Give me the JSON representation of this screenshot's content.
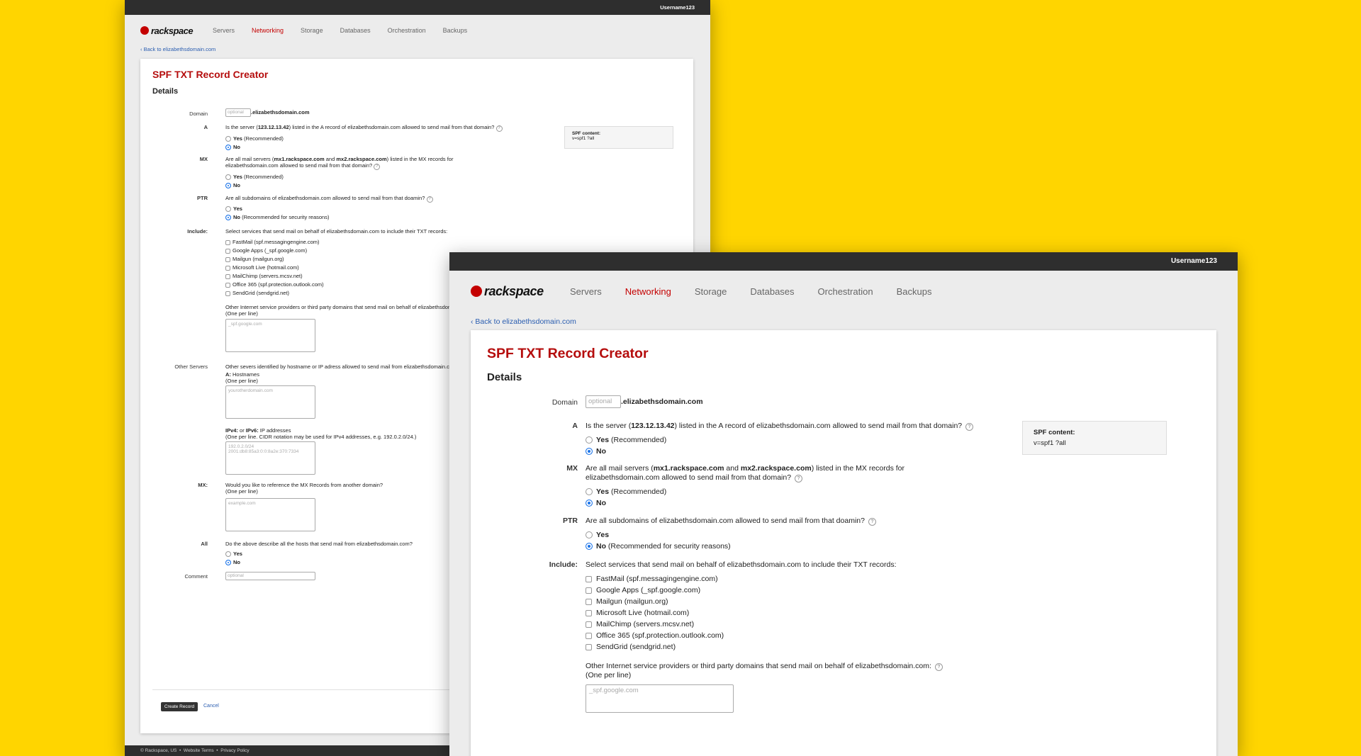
{
  "topbar": {
    "username": "Username123"
  },
  "nav": {
    "logo": "rackspace",
    "items": [
      "Servers",
      "Networking",
      "Storage",
      "Databases",
      "Orchestration",
      "Backups"
    ],
    "active": "Networking"
  },
  "back_link": "‹ Back to elizabethsdomain.com",
  "page": {
    "title": "SPF TXT Record Creator",
    "subtitle": "Details"
  },
  "domain": {
    "label": "Domain",
    "placeholder": "optional",
    "suffix": ".elizabethsdomain.com"
  },
  "spf": {
    "label": "SPF content:",
    "value": "v=spf1 ?all"
  },
  "a_record": {
    "label": "A",
    "q_pre": "Is the server (",
    "q_bold": "123.12.13.42",
    "q_post": ") listed in the A record of elizabethsdomain.com allowed to send mail from that domain?",
    "yes": "Yes",
    "yes_note": "(Recommended)",
    "no": "No"
  },
  "mx_record": {
    "label": "MX",
    "q_pre": "Are all mail servers (",
    "q_bold1": "mx1.rackspace.com",
    "q_mid": " and ",
    "q_bold2": "mx2.rackspace.com",
    "q_post1": ") listed in the MX records for",
    "q_post2": "elizabethsdomain.com allowed to send mail from that domain?",
    "yes": "Yes",
    "yes_note": "(Recommended)",
    "no": "No"
  },
  "ptr_record": {
    "label": "PTR",
    "q": "Are all subdomains of elizabethsdomain.com allowed to send mail from that doamin?",
    "yes": "Yes",
    "no": "No",
    "no_note": "(Recommended for security reasons)"
  },
  "include": {
    "label": "Include:",
    "q": "Select services that send mail on behalf of elizabethsdomain.com to include their TXT records:",
    "services": [
      "FastMail (spf.messagingengine.com)",
      "Google Apps (_spf.google.com)",
      "Mailgun (mailgun.org)",
      "Microsoft Live (hotmail.com)",
      "MailChimp (servers.mcsv.net)",
      "Office 365 (spf.protection.outlook.com)",
      "SendGrid (sendgrid.net)"
    ],
    "other_q": "Other Internet service providers or third party domains that send mail on behalf of elizabethsdomain.com:",
    "one_per_line": "(One per line)",
    "other_placeholder": "_spf.google.com"
  },
  "other_servers": {
    "label": "Other Servers",
    "q": "Other severs identified by hostname or IP adress allowed to send mail from elizabethsdomain.com:",
    "hostnames_bold": "A:",
    "hostnames": " Hostnames",
    "hostnames_hint": "(One per line)",
    "hostnames_placeholder": "yourotherdomain.com",
    "ip_bold1": "IPv4:",
    "ip_mid": " or ",
    "ip_bold2": "IPv6:",
    "ip_post": " IP addresses",
    "ip_hint": "(One per line. CIDR notation may be used for IPv4 addresses, e.g. 192.0.2.0/24.)",
    "ip_placeholder1": "192.0.2.0/24",
    "ip_placeholder2": "2001:db8:85a3:0:0:8a2e:370:7334"
  },
  "mx_ref": {
    "label": "MX:",
    "q": "Would you like to reference the MX Records from another domain?",
    "hint": "(One per line)",
    "placeholder": "example.com"
  },
  "all": {
    "label": "All",
    "q": "Do the above describe all the hosts that send mail from elizabethsdomain.com?",
    "yes": "Yes",
    "no": "No"
  },
  "comment": {
    "label": "Comment",
    "placeholder": "optional"
  },
  "actions": {
    "create": "Create Record",
    "cancel": "Cancel"
  },
  "footer": {
    "copyright": "© Rackspace, US",
    "terms": "Website Terms",
    "privacy": "Privacy Policy",
    "sep": "•"
  },
  "colors": {
    "background": "#FFD500",
    "brand_red": "#C40000",
    "title_red": "#B50D0D",
    "link_blue": "#2A5DB0",
    "radio_blue": "#1A73E8",
    "topbar": "#2E2E2E"
  }
}
